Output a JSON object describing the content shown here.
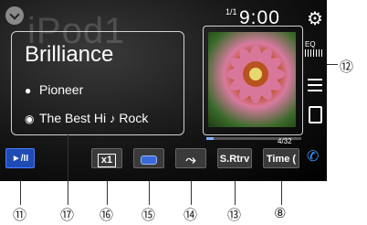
{
  "source": {
    "name": "iPod",
    "name_visible": "iPod1",
    "back_icon": "back-arrow-icon"
  },
  "status": {
    "track_number": "1/1",
    "clock": "9:00"
  },
  "now_playing": {
    "title": "Brilliance",
    "artist": "Pioneer",
    "album": "The Best Hi",
    "genre": "Rock",
    "artist_icon": "person-icon",
    "album_icon": "disc-icon",
    "genre_icon": "guitar-icon"
  },
  "artwork": {
    "description": "flower"
  },
  "track_count": "4/32",
  "right_panel": {
    "settings_icon": "gear-icon",
    "eq_label": "EQ",
    "list_icon": "list-icon",
    "device_icon": "device-icon"
  },
  "controls": {
    "play_pause": "►/II",
    "speed": "x1",
    "shuffle": "⤳",
    "srtrv": "S.Rtrv",
    "time": "Time ("
  },
  "phone_icon": "phone-icon",
  "progress": 0.08,
  "callouts": {
    "c11": "⑪",
    "c17": "⑰",
    "c16": "⑯",
    "c15": "⑮",
    "c14": "⑭",
    "c13": "⑬",
    "c8": "⑧",
    "c12": "⑫"
  },
  "colors": {
    "accent": "#1e4cb4",
    "phone": "#3a9cff"
  }
}
